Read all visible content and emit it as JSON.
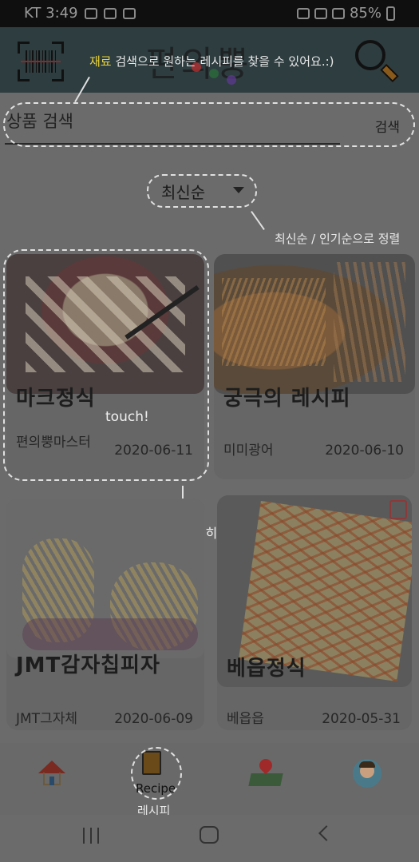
{
  "status_bar": {
    "carrier_time": "KT 3:49",
    "battery": "85%"
  },
  "header": {
    "logo_text": "편의뿡",
    "hint": {
      "highlight": "재료",
      "rest": " 검색으로 원하는 레시피를 찾을 수 있어요.:)"
    }
  },
  "search": {
    "placeholder": "상품 검색",
    "action_label": "검색"
  },
  "sort": {
    "selected": "최신순",
    "hint": "최신순 / 인기순으로 정렬"
  },
  "guide": {
    "touch": "touch!",
    "detail": "자세히 보기"
  },
  "cards": [
    {
      "title": "마크정식",
      "author": "편의뿡마스터",
      "date": "2020-06-11"
    },
    {
      "title": "궁극의 레시피",
      "author": "미미광어",
      "date": "2020-06-10"
    },
    {
      "title": "JMT감자칩피자",
      "author": "JMT그자체",
      "date": "2020-06-09"
    },
    {
      "title": "베읍정식",
      "author": "베읍읍",
      "date": "2020-05-31"
    }
  ],
  "bottom_nav": {
    "recipe_label": "Recipe",
    "recipe_caption": "레시피"
  },
  "icons": [
    "barcode-icon",
    "search-icon",
    "home-icon",
    "recipe-book-icon",
    "map-pin-icon",
    "profile-avatar-icon",
    "bookmark-icon"
  ],
  "colors": {
    "overlay": "#6b6b6b",
    "header": "#2e3d40",
    "highlight": "#e8d23a"
  }
}
